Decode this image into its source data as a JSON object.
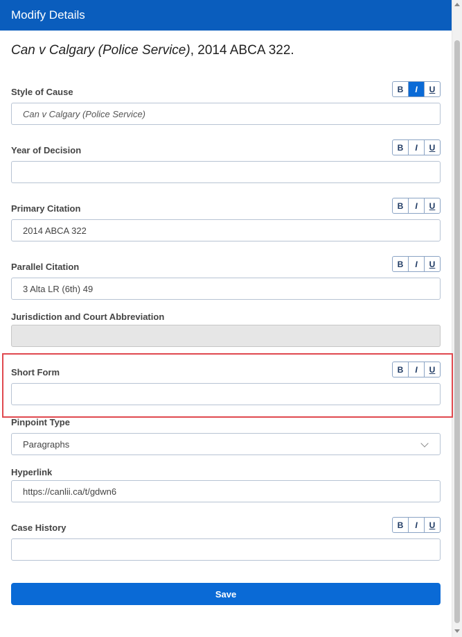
{
  "header": {
    "title": "Modify Details"
  },
  "case_title": {
    "italic": "Can v Calgary (Police Service)",
    "rest": ", 2014 ABCA 322."
  },
  "format_buttons": {
    "bold": "B",
    "italic": "I",
    "underline": "U"
  },
  "fields": {
    "style_of_cause": {
      "label": "Style of Cause",
      "value": "Can v Calgary (Police Service)",
      "italic_active": true
    },
    "year_of_decision": {
      "label": "Year of Decision",
      "value": ""
    },
    "primary_citation": {
      "label": "Primary Citation",
      "value": "2014 ABCA 322"
    },
    "parallel_citation": {
      "label": "Parallel Citation",
      "value": "3 Alta LR (6th) 49"
    },
    "jurisdiction": {
      "label": "Jurisdiction and Court Abbreviation",
      "value": ""
    },
    "short_form": {
      "label": "Short Form",
      "value": ""
    },
    "pinpoint_type": {
      "label": "Pinpoint Type",
      "value": "Paragraphs"
    },
    "hyperlink": {
      "label": "Hyperlink",
      "value": "https://canlii.ca/t/gdwn6"
    },
    "case_history": {
      "label": "Case History",
      "value": ""
    }
  },
  "save_label": "Save",
  "colors": {
    "header_bg": "#0a5dbd",
    "primary": "#0a6ad6",
    "highlight": "#e0484e"
  }
}
